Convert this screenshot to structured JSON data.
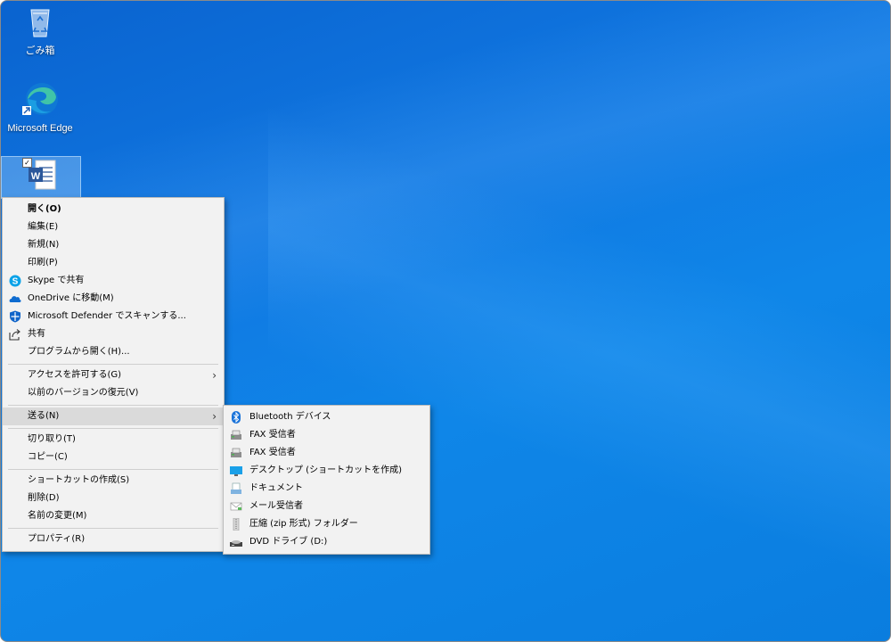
{
  "desktop": {
    "icons": [
      {
        "label": "ごみ箱",
        "icon": "recycle-bin-icon"
      },
      {
        "label": "Microsoft Edge",
        "icon": "edge-icon"
      },
      {
        "label": "",
        "icon": "word-document-icon"
      }
    ]
  },
  "context_menu": {
    "items": [
      {
        "label": "開く(O)",
        "bold": true
      },
      {
        "label": "編集(E)"
      },
      {
        "label": "新規(N)"
      },
      {
        "label": "印刷(P)"
      },
      {
        "label": "Skype で共有",
        "icon": "skype-icon"
      },
      {
        "label": "OneDrive に移動(M)",
        "icon": "onedrive-icon"
      },
      {
        "label": "Microsoft Defender でスキャンする...",
        "icon": "defender-shield-icon"
      },
      {
        "label": "共有",
        "icon": "share-icon"
      },
      {
        "label": "プログラムから開く(H)..."
      },
      {
        "label": "アクセスを許可する(G)",
        "submenu": true
      },
      {
        "label": "以前のバージョンの復元(V)"
      },
      {
        "label": "送る(N)",
        "submenu": true,
        "highlighted": true
      },
      {
        "label": "切り取り(T)"
      },
      {
        "label": "コピー(C)"
      },
      {
        "label": "ショートカットの作成(S)"
      },
      {
        "label": "削除(D)"
      },
      {
        "label": "名前の変更(M)"
      },
      {
        "label": "プロパティ(R)"
      }
    ]
  },
  "send_to_menu": {
    "items": [
      {
        "label": "Bluetooth デバイス",
        "icon": "bluetooth-icon"
      },
      {
        "label": "FAX 受信者",
        "icon": "fax-icon"
      },
      {
        "label": "FAX 受信者",
        "icon": "fax-icon"
      },
      {
        "label": "デスクトップ (ショートカットを作成)",
        "icon": "desktop-icon"
      },
      {
        "label": "ドキュメント",
        "icon": "documents-icon"
      },
      {
        "label": "メール受信者",
        "icon": "mail-icon"
      },
      {
        "label": "圧縮 (zip 形式) フォルダー",
        "icon": "zip-folder-icon"
      },
      {
        "label": "DVD ドライブ (D:)",
        "icon": "dvd-drive-icon"
      }
    ]
  },
  "colors": {
    "desktop": "#0f7fe3",
    "menu_bg": "#f2f2f2",
    "highlight": "#dadada"
  }
}
